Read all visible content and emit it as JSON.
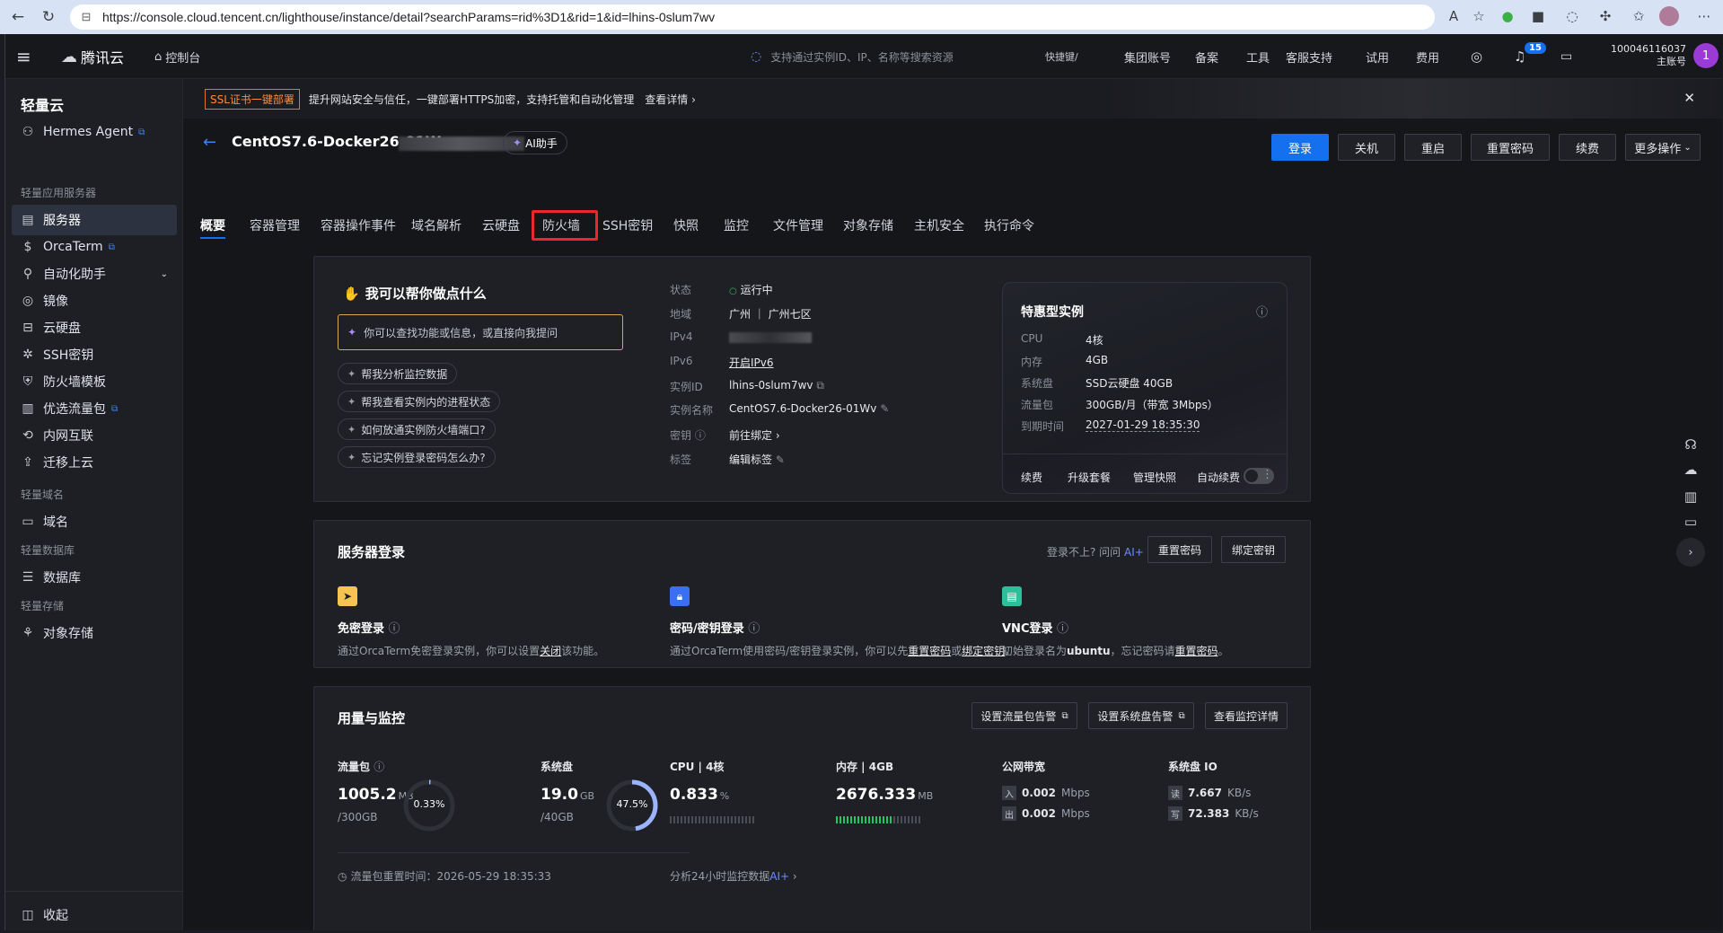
{
  "browser": {
    "url": "https://console.cloud.tencent.cn/lighthouse/instance/detail?searchParams=rid%3D1&rid=1&id=lhins-0slum7wv"
  },
  "topnav": {
    "brand": "腾讯云",
    "console": "控制台",
    "search_placeholder": "支持通过实例ID、IP、名称等搜索资源",
    "shortcut": "快捷键/",
    "links": [
      "集团账号",
      "备案",
      "工具",
      "客服支持",
      "试用",
      "费用"
    ],
    "notif_count": "15",
    "account_id": "100046116037",
    "account_role": "主账号",
    "avatar": "1"
  },
  "sidebar": {
    "title": "轻量云",
    "hermes": "Hermes Agent",
    "group1": "轻量应用服务器",
    "items": [
      "服务器",
      "OrcaTerm",
      "自动化助手",
      "镜像",
      "云硬盘",
      "SSH密钥",
      "防火墙模板",
      "优选流量包",
      "内网互联",
      "迁移上云"
    ],
    "group2": "轻量域名",
    "domain": "域名",
    "group3": "轻量数据库",
    "database": "数据库",
    "group4": "轻量存储",
    "storage": "对象存储",
    "collapse": "收起"
  },
  "banner": {
    "tag": "SSL证书一键部署",
    "text": "提升网站安全与信任，一键部署HTTPS加密，支持托管和自动化管理",
    "link": "查看详情"
  },
  "instance": {
    "title": "CentOS7.6-Docker26-01Wv",
    "ai_label": "AI助手",
    "actions": [
      "登录",
      "关机",
      "重启",
      "重置密码",
      "续费",
      "更多操作"
    ]
  },
  "tabs": [
    "概要",
    "容器管理",
    "容器操作事件",
    "域名解析",
    "云硬盘",
    "防火墙",
    "SSH密钥",
    "快照",
    "监控",
    "文件管理",
    "对象存储",
    "主机安全",
    "执行命令"
  ],
  "assistant": {
    "title": "我可以帮你做点什么",
    "input_placeholder": "你可以查找功能或信息，或直接向我提问",
    "suggestions": [
      "帮我分析监控数据",
      "帮我查看实例内的进程状态",
      "如何放通实例防火墙端口?",
      "忘记实例登录密码怎么办?"
    ]
  },
  "info": {
    "labels": [
      "状态",
      "地域",
      "IPv4",
      "IPv6",
      "实例ID",
      "实例名称",
      "密钥",
      "标签"
    ],
    "status": "运行中",
    "region": "广州 ｜ 广州七区",
    "ipv6": "开启IPv6",
    "instance_id": "lhins-0slum7wv",
    "instance_name": "CentOS7.6-Docker26-01Wv",
    "key": "前往绑定",
    "tag": "编辑标签"
  },
  "spec": {
    "title": "特惠型实例",
    "labels": [
      "CPU",
      "内存",
      "系统盘",
      "流量包",
      "到期时间"
    ],
    "values": [
      "4核",
      "4GB",
      "SSD云硬盘 40GB",
      "300GB/月（带宽 3Mbps）",
      "2027-01-29 18:35:30"
    ],
    "actions": [
      "续费",
      "升级套餐",
      "管理快照"
    ],
    "auto_renew": "自动续费"
  },
  "login": {
    "title": "服务器登录",
    "help": "登录不上? 问问",
    "ai": "AI+",
    "reset_btn": "重置密码",
    "bind_btn": "绑定密钥",
    "methods": [
      {
        "title": "免密登录",
        "desc_a": "通过OrcaTerm免密登录实例，你可以设置",
        "link1": "关闭",
        "desc_b": "该功能。",
        "link2": "",
        "desc_c": ""
      },
      {
        "title": "密码/密钥登录",
        "desc_a": "通过OrcaTerm使用密码/密钥登录实例，你可以先",
        "link1": "重置密码",
        "desc_b": "或",
        "link2": "绑定密钥",
        "desc_c": "。"
      },
      {
        "title": "VNC登录",
        "desc_a": "初始登录名为",
        "link1": "ubuntu",
        "desc_b": "，忘记密码请",
        "link2": "重置密码",
        "desc_c": "。"
      }
    ]
  },
  "usage": {
    "title": "用量与监控",
    "buttons": [
      "设置流量包告警",
      "设置系统盘告警",
      "查看监控详情"
    ],
    "traffic_label": "流量包",
    "traffic_value": "1005.2",
    "traffic_unit": "MB",
    "traffic_total": "/300GB",
    "traffic_pct": "0.33%",
    "traffic_fraction": 0.0033,
    "disk_label": "系统盘",
    "disk_value": "19.0",
    "disk_unit": "GB",
    "disk_total": "/40GB",
    "disk_pct": "47.5%",
    "disk_fraction": 0.475,
    "cpu_label": "CPU | 4核",
    "cpu_value": "0.833",
    "cpu_unit": "%",
    "cpu_fraction": 0.008,
    "mem_label": "内存 | 4GB",
    "mem_value": "2676.333",
    "mem_unit": "MB",
    "mem_fraction": 0.65,
    "bw_label": "公网带宽",
    "bw_in": "0.002",
    "bw_out": "0.002",
    "bw_unit": "Mbps",
    "bw_in_icon": "入",
    "bw_out_icon": "出",
    "io_label": "系统盘 IO",
    "io_read": "7.667",
    "io_write": "72.383",
    "io_unit": "KB/s",
    "io_read_icon": "读",
    "io_write_icon": "写",
    "reset_time": "流量包重置时间：2026-05-29 18:35:33",
    "analyze": "分析24小时监控数据",
    "analyze_ai": "AI+"
  }
}
